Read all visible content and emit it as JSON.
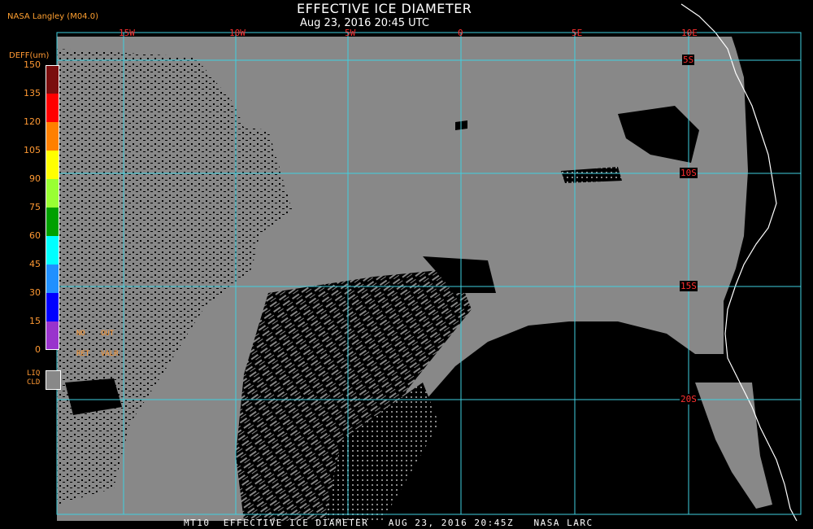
{
  "header": {
    "title": "EFFECTIVE ICE DIAMETER",
    "subtitle": "Aug 23, 2016 20:45 UTC",
    "credit": "NASA Langley (M04.0)"
  },
  "legend": {
    "title": "DEFF(um)",
    "ticks": [
      "150",
      "135",
      "120",
      "105",
      "90",
      "75",
      "60",
      "45",
      "30",
      "15",
      "0"
    ],
    "colors": [
      "#7a0e0e",
      "#ff0000",
      "#ff8000",
      "#ffff00",
      "#99ff33",
      "#00a000",
      "#00ffff",
      "#2090ff",
      "#0000ff",
      "#9933cc"
    ],
    "no_ret_top": "NO",
    "no_ret_bottom": "RET",
    "out_valr_top": "OUT",
    "out_valr_bottom": "VALR",
    "liq_top": "LIQ",
    "liq_bottom": "CLD",
    "liquid_color": "#888888"
  },
  "grid": {
    "longitude_labels": [
      "15W",
      "10W",
      "5W",
      "0",
      "5E",
      "10E"
    ],
    "latitude_labels": [
      "5S",
      "10S",
      "15S",
      "20S"
    ],
    "grid_color": "#40d0e0"
  },
  "footer": {
    "text": "MT10  EFFECTIVE ICE DIAMETER   AUG 23, 2016 20:45Z   NASA LARC"
  },
  "map": {
    "cloud_color": "#888888",
    "background_color": "#000000",
    "coast_color": "#ffffff"
  }
}
